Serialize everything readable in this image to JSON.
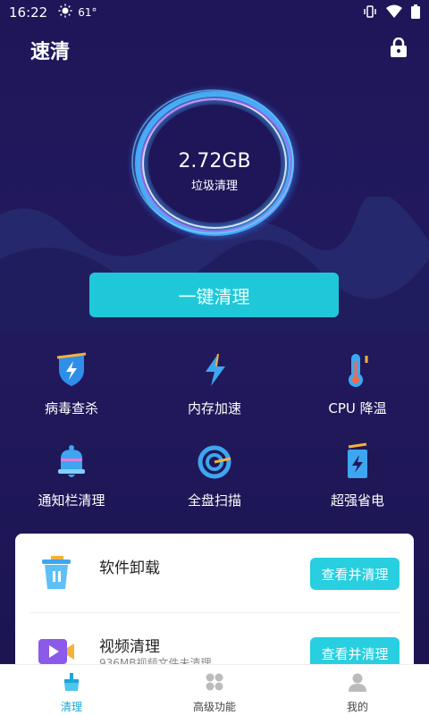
{
  "status_bar": {
    "time": "16:22",
    "temperature": "61°"
  },
  "header": {
    "title": "速清"
  },
  "junk": {
    "size": "2.72GB",
    "label": "垃圾清理"
  },
  "primary_action": {
    "label": "一键清理"
  },
  "features": [
    {
      "label": "病毒查杀",
      "icon": "shield-bolt-icon"
    },
    {
      "label": "内存加速",
      "icon": "lightning-icon"
    },
    {
      "label": "CPU 降温",
      "icon": "thermometer-icon"
    },
    {
      "label": "通知栏清理",
      "icon": "bell-icon"
    },
    {
      "label": "全盘扫描",
      "icon": "scan-icon"
    },
    {
      "label": "超强省电",
      "icon": "battery-icon"
    }
  ],
  "card": {
    "rows": [
      {
        "title": "软件卸载",
        "subtitle": "",
        "button": "查看并清理",
        "icon": "trash-icon"
      },
      {
        "title": "视频清理",
        "subtitle": "936MB视频文件未清理",
        "button": "查看并清理",
        "icon": "video-icon"
      }
    ]
  },
  "bottom_nav": [
    {
      "label": "清理",
      "icon": "broom-icon",
      "active": true
    },
    {
      "label": "高级功能",
      "icon": "grid-icon",
      "active": false
    },
    {
      "label": "我的",
      "icon": "person-icon",
      "active": false
    }
  ],
  "colors": {
    "accent": "#1fc8d8",
    "background": "#1e1658",
    "active_nav": "#1aa6d8"
  }
}
